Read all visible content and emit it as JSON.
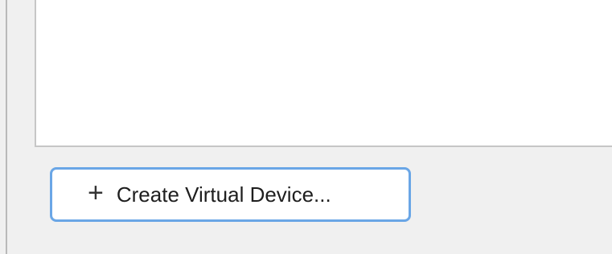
{
  "toolbar": {
    "create_button": {
      "icon": "plus-icon",
      "icon_glyph": "+",
      "label": "Create Virtual Device..."
    }
  },
  "colors": {
    "background": "#f0f0f0",
    "panel": "#ffffff",
    "button_border": "#6aa6e6"
  }
}
